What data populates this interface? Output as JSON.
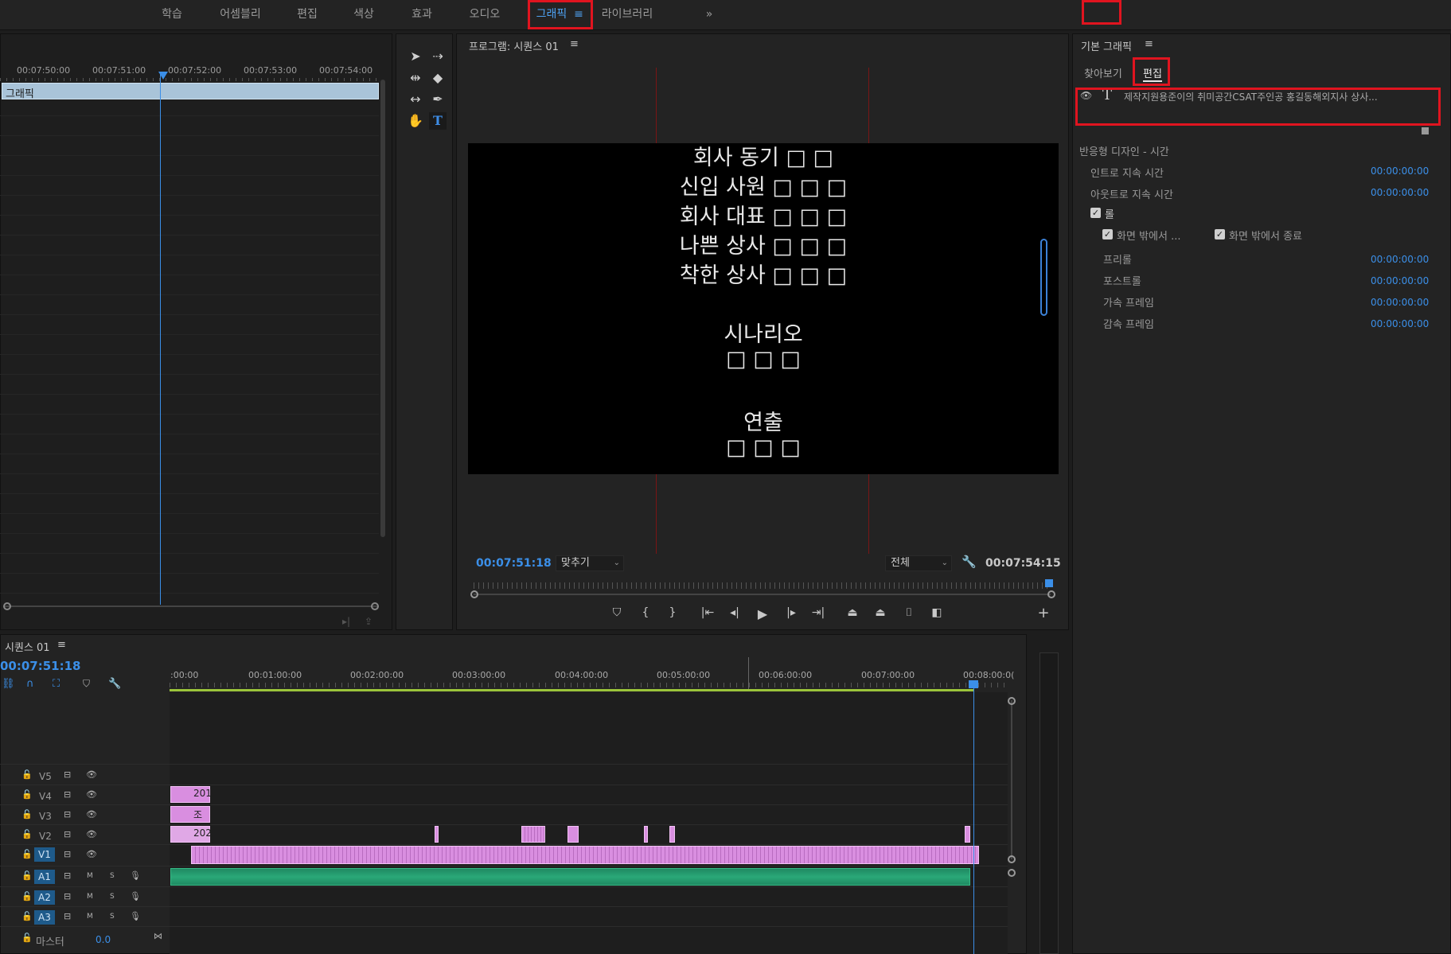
{
  "workspace_tabs": [
    "학습",
    "어셈블리",
    "편집",
    "색상",
    "효과",
    "오디오",
    "그래픽",
    "라이브러리"
  ],
  "workspace_active": "그래픽",
  "workspace_more": "»",
  "source_timeline": {
    "timecodes": [
      "00:07:50:00",
      "00:07:51:00",
      "00:07:52:00",
      "00:07:53:00",
      "00:07:54:00"
    ],
    "clip_label": "그래픽"
  },
  "program": {
    "title": "프로그램: 시퀀스 01",
    "menu_icon": "≡",
    "credits": [
      "회사 동기 □ □",
      "신입 사원 □ □ □",
      "회사 대표 □ □ □",
      "나쁜 상사 □ □ □",
      "착한 상사 □ □ □",
      "시나리오",
      "□ □ □",
      "연출",
      "□ □ □"
    ],
    "current_tc": "00:07:51:18",
    "fit_label": "맞추기",
    "quality_label": "전체",
    "duration_tc": "00:07:54:15"
  },
  "essential_graphics": {
    "title": "기본 그래픽",
    "tab_browse": "찾아보기",
    "tab_edit": "편집",
    "layer_text": "제작지원용준이의 취미공간CSAT주인공 홍길동해외지사 상사...",
    "section_title": "반응형 디자인 - 시간",
    "intro_label": "인트로 지속 시간",
    "intro_val": "00:00:00:00",
    "outro_label": "아웃트로 지속 시간",
    "outro_val": "00:00:00:00",
    "roll_label": "롤",
    "start_offscreen": "화면 밖에서 ...",
    "end_offscreen": "화면 밖에서 종료",
    "preroll_label": "프리롤",
    "preroll_val": "00:00:00:00",
    "postroll_label": "포스트롤",
    "postroll_val": "00:00:00:00",
    "ease_in_label": "가속 프레임",
    "ease_in_val": "00:00:00:00",
    "ease_out_label": "감속 프레임",
    "ease_out_val": "00:00:00:00"
  },
  "sequence": {
    "title": "시퀀스 01",
    "menu_icon": "≡",
    "current_tc": "00:07:51:18",
    "ruler": [
      ":00:00",
      "00:01:00:00",
      "00:02:00:00",
      "00:03:00:00",
      "00:04:00:00",
      "00:05:00:00",
      "00:06:00:00",
      "00:07:00:00",
      "00:08:00:0("
    ],
    "video_tracks": [
      "V5",
      "V4",
      "V3",
      "V2",
      "V1"
    ],
    "audio_tracks": [
      "A1",
      "A2",
      "A3"
    ],
    "master_label": "마스터",
    "master_val": "0.0",
    "clip_v4": "201",
    "clip_v3": "조각",
    "clip_v2": "202",
    "audio_m": "M",
    "audio_s": "S"
  },
  "colors": {
    "accent": "#3b8fe8",
    "highlight": "#e0141f",
    "video_clip": "#d98ee0",
    "audio_clip": "#1f8a62"
  }
}
